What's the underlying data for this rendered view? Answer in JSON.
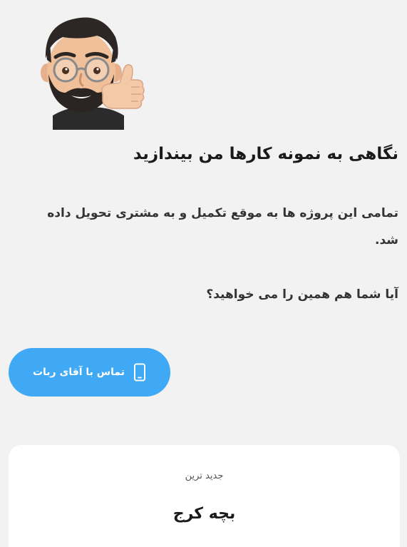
{
  "hero": {
    "title": "نگاهی به نمونه کارها من بیندازید",
    "description": "تمامی این پروژه ها به موقع تکمیل و به مشتری تحویل داده شد.",
    "question": "آیا شما هم همین را می خواهید؟"
  },
  "cta": {
    "label": "تماس با آقای ربات",
    "icon": "phone-icon",
    "color": "#3fa9f5"
  },
  "card": {
    "label": "جدید ترین",
    "title": "بچه کرج"
  },
  "colors": {
    "background": "#f2f2f2",
    "card": "#ffffff",
    "text": "#1a1a1a"
  }
}
